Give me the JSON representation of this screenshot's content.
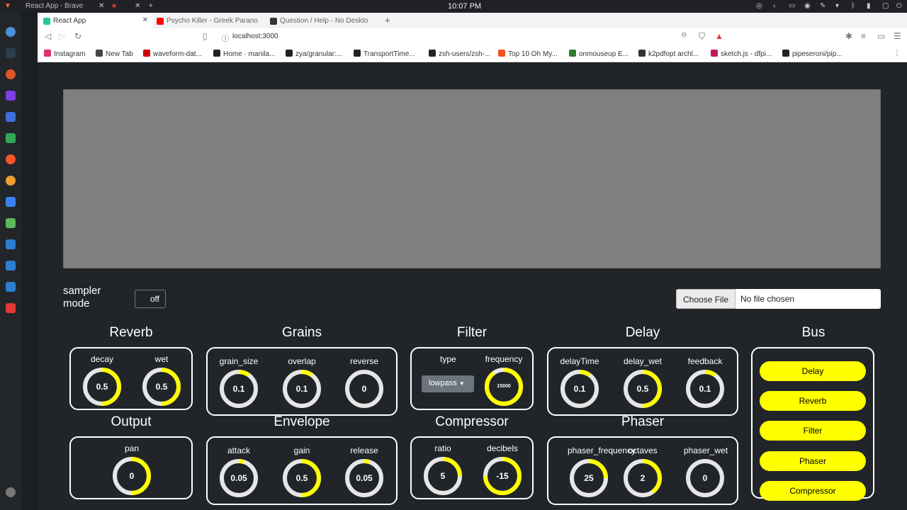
{
  "os": {
    "active_tab_title": "React App - Brave",
    "clock": "10:07 PM"
  },
  "browser": {
    "tabs": [
      {
        "label": "React App",
        "favicon_color": "#20c997"
      },
      {
        "label": "Psycho Killer - Greek Parano",
        "favicon_color": "#ff0000"
      },
      {
        "label": "Question / Help - No Deskto",
        "favicon_color": "#333333"
      }
    ],
    "url": "localhost:3000",
    "bookmarks": [
      {
        "label": "Instagram",
        "color": "#e1306c"
      },
      {
        "label": "New Tab",
        "color": "#444444"
      },
      {
        "label": "waveform-dat...",
        "color": "#cc0000"
      },
      {
        "label": "Home · manila...",
        "color": "#222222"
      },
      {
        "label": "zya/granular:...",
        "color": "#222222"
      },
      {
        "label": "TransportTime...",
        "color": "#222222"
      },
      {
        "label": "zsh-users/zsh-...",
        "color": "#222222"
      },
      {
        "label": "Top 10 Oh My...",
        "color": "#f4511e"
      },
      {
        "label": "onmouseup E...",
        "color": "#2e7d32"
      },
      {
        "label": "k2pdfopt archl...",
        "color": "#333333"
      },
      {
        "label": "sketch.js - dfpi...",
        "color": "#c2185b"
      },
      {
        "label": "pipeseroni/pip...",
        "color": "#222222"
      }
    ]
  },
  "app": {
    "sampler_mode_label": "sampler mode",
    "sampler_toggle": "off",
    "file_button": "Choose File",
    "file_status": "No file chosen",
    "accent_color": "#ffff00",
    "sections": {
      "reverb": {
        "title": "Reverb",
        "knobs": [
          {
            "label": "decay",
            "value": "0.5",
            "fill": 0.5
          },
          {
            "label": "wet",
            "value": "0.5",
            "fill": 0.5
          }
        ]
      },
      "grains": {
        "title": "Grains",
        "knobs": [
          {
            "label": "grain_size",
            "value": "0.1",
            "fill": 0.1
          },
          {
            "label": "overlap",
            "value": "0.1",
            "fill": 0.1
          },
          {
            "label": "reverse",
            "value": "0",
            "fill": 0
          }
        ]
      },
      "filter": {
        "title": "Filter",
        "type_label": "type",
        "type_value": "lowpass",
        "knobs": [
          {
            "label": "frequency",
            "value": "15000",
            "fill": 0.9
          }
        ]
      },
      "delay": {
        "title": "Delay",
        "knobs": [
          {
            "label": "delayTime",
            "value": "0.1",
            "fill": 0.1
          },
          {
            "label": "delay_wet",
            "value": "0.5",
            "fill": 0.5
          },
          {
            "label": "feedback",
            "value": "0.1",
            "fill": 0.1
          }
        ]
      },
      "output": {
        "title": "Output",
        "knobs": [
          {
            "label": "pan",
            "value": "0",
            "fill": 0.5
          }
        ]
      },
      "envelope": {
        "title": "Envelope",
        "knobs": [
          {
            "label": "attack",
            "value": "0.05",
            "fill": 0.05
          },
          {
            "label": "gain",
            "value": "0.5",
            "fill": 0.5
          },
          {
            "label": "release",
            "value": "0.05",
            "fill": 0.05
          }
        ]
      },
      "compressor": {
        "title": "Compressor",
        "knobs": [
          {
            "label": "ratio",
            "value": "5",
            "fill": 0.25
          },
          {
            "label": "decibels",
            "value": "-15",
            "fill": 0.75
          }
        ]
      },
      "phaser": {
        "title": "Phaser",
        "knobs": [
          {
            "label": "phaser_frequency",
            "value": "25",
            "fill": 0.25
          },
          {
            "label": "octaves",
            "value": "2",
            "fill": 0.4
          },
          {
            "label": "phaser_wet",
            "value": "0",
            "fill": 0
          }
        ]
      },
      "bus": {
        "title": "Bus",
        "buttons": [
          "Delay",
          "Reverb",
          "Filter",
          "Phaser",
          "Compressor"
        ]
      }
    }
  }
}
